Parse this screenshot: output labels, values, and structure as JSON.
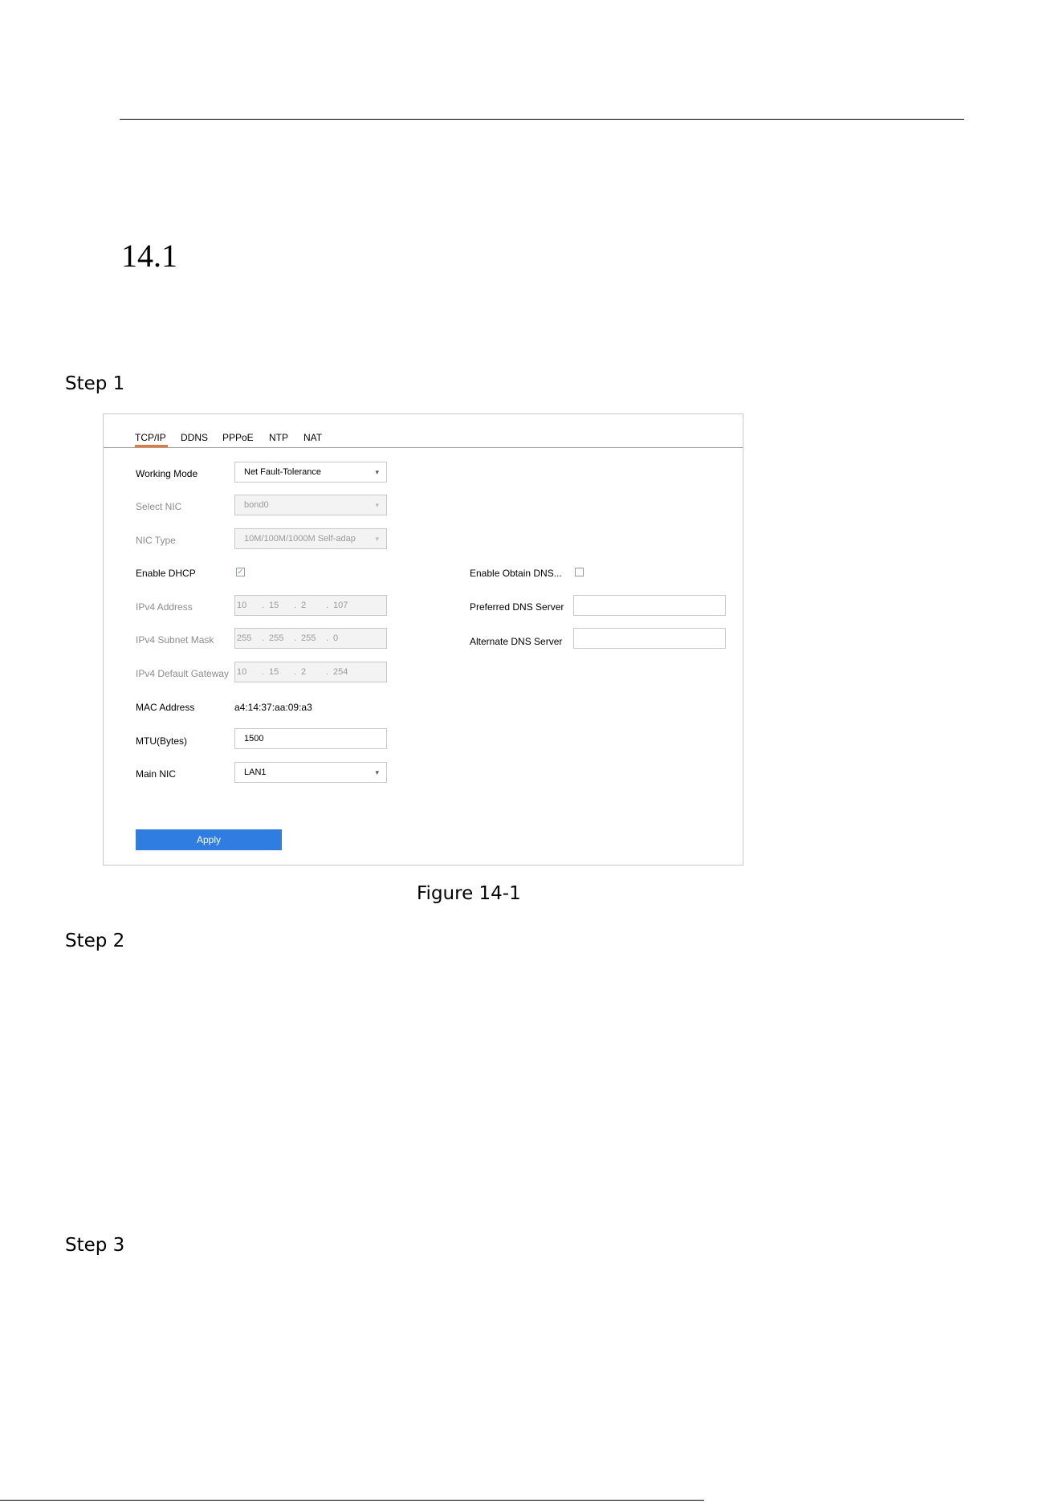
{
  "document": {
    "section_number": "14.1",
    "steps": [
      "Step 1",
      "Step 2",
      "Step 3"
    ],
    "figure_caption": "Figure 14-1"
  },
  "ui": {
    "tabs": [
      "TCP/IP",
      "DDNS",
      "PPPoE",
      "NTP",
      "NAT"
    ],
    "active_tab": "TCP/IP",
    "colors": {
      "accent_tab": "#e07b39",
      "apply_button": "#2f7de1"
    },
    "fields": {
      "working_mode": {
        "label": "Working Mode",
        "value": "Net Fault-Tolerance"
      },
      "select_nic": {
        "label": "Select NIC",
        "value": "bond0"
      },
      "nic_type": {
        "label": "NIC Type",
        "value": "10M/100M/1000M Self-adap"
      },
      "enable_dhcp": {
        "label": "Enable DHCP",
        "checked": true
      },
      "ipv4_address": {
        "label": "IPv4 Address",
        "octets": [
          "10",
          "15",
          "2",
          "107"
        ]
      },
      "ipv4_subnet_mask": {
        "label": "IPv4 Subnet Mask",
        "octets": [
          "255",
          "255",
          "255",
          "0"
        ]
      },
      "ipv4_default_gateway": {
        "label": "IPv4 Default Gateway",
        "octets": [
          "10",
          "15",
          "2",
          "254"
        ]
      },
      "mac_address": {
        "label": "MAC Address",
        "value": "a4:14:37:aa:09:a3"
      },
      "mtu": {
        "label": "MTU(Bytes)",
        "value": "1500"
      },
      "main_nic": {
        "label": "Main NIC",
        "value": "LAN1"
      },
      "enable_obtain_dns": {
        "label": "Enable Obtain DNS...",
        "checked": false
      },
      "preferred_dns": {
        "label": "Preferred DNS Server",
        "value": ""
      },
      "alternate_dns": {
        "label": "Alternate DNS Server",
        "value": ""
      }
    },
    "apply_label": "Apply"
  }
}
